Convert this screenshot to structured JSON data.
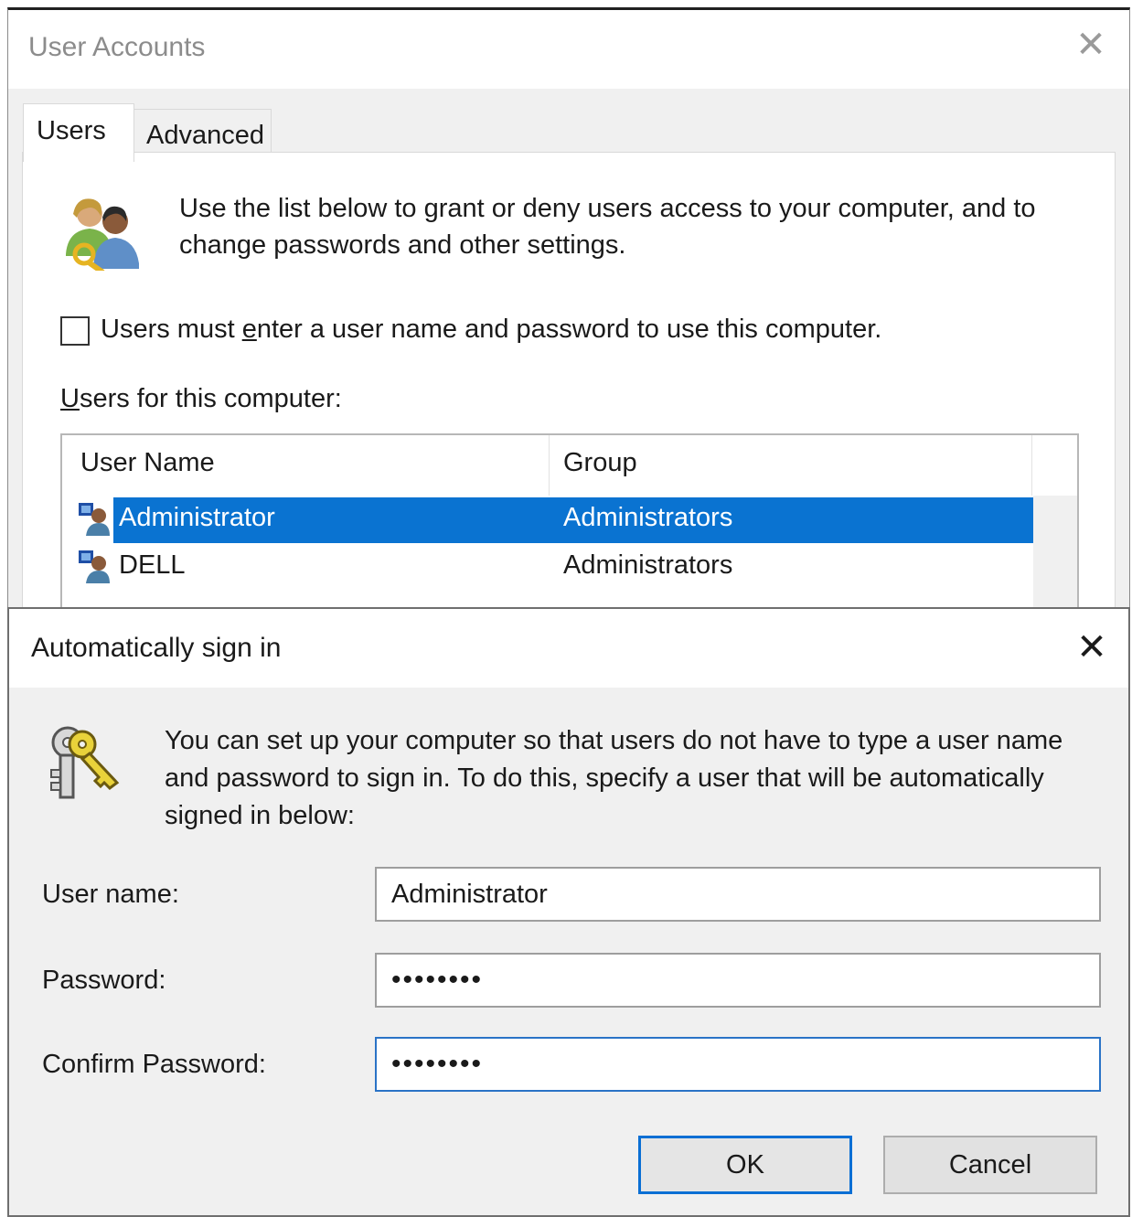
{
  "user_accounts": {
    "title": "User Accounts",
    "close_glyph": "✕",
    "tabs": [
      {
        "label": "Users",
        "active": true
      },
      {
        "label": "Advanced",
        "active": false
      }
    ],
    "intro_text": "Use the list below to grant or deny users access to your computer, and to change passwords and other settings.",
    "require_login_checkbox": {
      "label_prefix": "Users must ",
      "label_underlined": "e",
      "label_suffix": "nter a user name and password to use this computer.",
      "checked": false
    },
    "users_list_label_underlined": "U",
    "users_list_label_rest": "sers for this computer:",
    "columns": [
      "User Name",
      "Group"
    ],
    "rows": [
      {
        "name": "Administrator",
        "group": "Administrators",
        "selected": true
      },
      {
        "name": "DELL",
        "group": "Administrators",
        "selected": false
      }
    ],
    "icon": "users-icon",
    "selection_color": "#0a73d1"
  },
  "auto_sign_in": {
    "title": "Automatically sign in",
    "close_glyph": "✕",
    "icon": "keys-icon",
    "intro_text": "You can set up your computer so that users do not have to type a user name and password to sign in. To do this, specify a user that will be automatically signed in below:",
    "fields": {
      "user_name_label": "User name:",
      "user_name_value": "Administrator",
      "password_label": "Password:",
      "password_value": "••••••••",
      "confirm_label": "Confirm Password:",
      "confirm_value": "••••••••"
    },
    "buttons": {
      "ok": "OK",
      "cancel": "Cancel"
    },
    "accent_color": "#0a6fd4"
  }
}
